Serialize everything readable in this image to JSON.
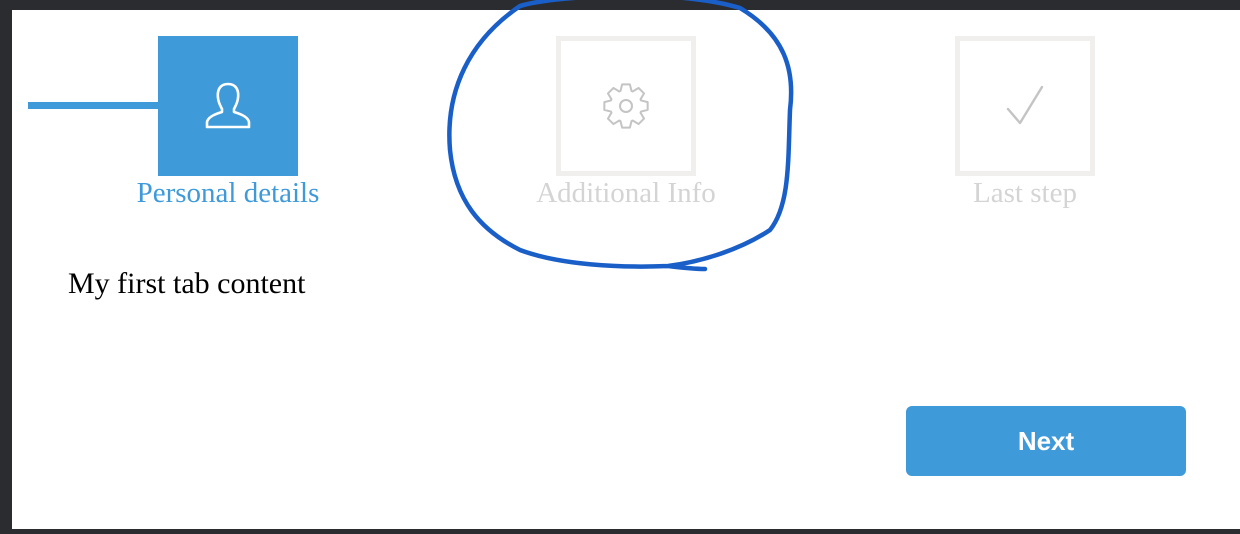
{
  "wizard": {
    "steps": [
      {
        "label": "Personal details",
        "icon": "user-icon",
        "state": "active"
      },
      {
        "label": "Additional Info",
        "icon": "gear-icon",
        "state": "inactive"
      },
      {
        "label": "Last step",
        "icon": "checkmark-icon",
        "state": "inactive"
      }
    ],
    "tab_content": "My first tab content",
    "next_label": "Next"
  },
  "colors": {
    "accent": "#3e9ad9",
    "inactive_border": "#f1efee",
    "inactive_text": "#d4d4d4",
    "annotation_stroke": "#1a5fc8"
  }
}
